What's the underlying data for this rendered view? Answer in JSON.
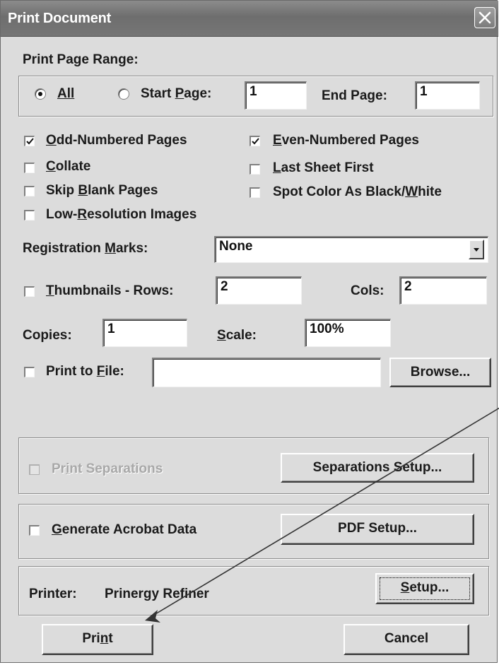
{
  "window": {
    "title": "Print Document"
  },
  "page_range": {
    "label": "Print Page Range:",
    "all_label": "All",
    "all_selected": true,
    "start_label": "Start Page:",
    "start_value": "1",
    "end_label": "End Page:",
    "end_value": "1"
  },
  "options": {
    "odd_pages": {
      "label": "Odd-Numbered Pages",
      "checked": true
    },
    "even_pages": {
      "label": "Even-Numbered Pages",
      "checked": true
    },
    "collate": {
      "label": "Collate",
      "checked": false
    },
    "last_sheet_first": {
      "label": "Last Sheet First",
      "checked": false
    },
    "skip_blank": {
      "label": "Skip Blank Pages",
      "checked": false
    },
    "spot_color": {
      "label": "Spot Color As Black/White",
      "checked": false
    },
    "low_res": {
      "label": "Low-Resolution Images",
      "checked": false
    }
  },
  "registration": {
    "label": "Registration Marks:",
    "value": "None"
  },
  "thumbnails": {
    "label": "Thumbnails - Rows:",
    "checked": false,
    "rows_value": "2",
    "cols_label": "Cols:",
    "cols_value": "2"
  },
  "copies": {
    "label": "Copies:",
    "value": "1"
  },
  "scale": {
    "label": "Scale:",
    "value": "100%"
  },
  "print_to_file": {
    "label": "Print to File:",
    "value": "",
    "browse_label": "Browse..."
  },
  "separations": {
    "label": "Print Separations",
    "enabled": false,
    "setup_label": "Separations Setup..."
  },
  "acrobat": {
    "label": "Generate Acrobat Data",
    "checked": false,
    "setup_label": "PDF Setup..."
  },
  "printer": {
    "label": "Printer:",
    "name": "Prinergy Refiner",
    "setup_label": "Setup..."
  },
  "actions": {
    "print_label": "Print",
    "cancel_label": "Cancel"
  }
}
